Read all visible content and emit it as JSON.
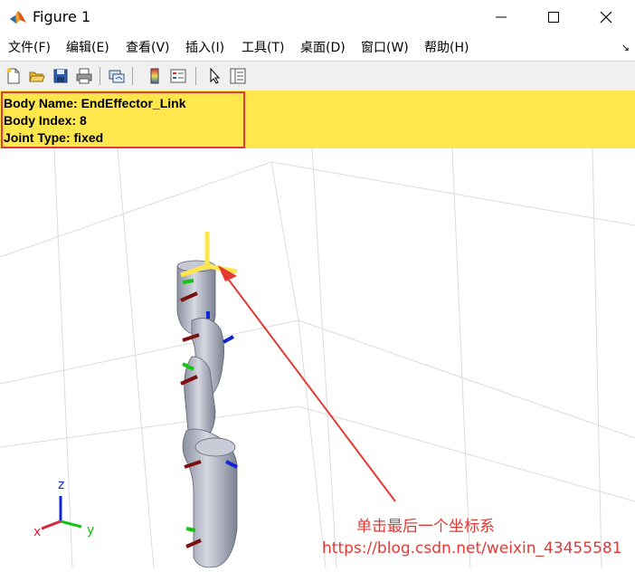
{
  "window": {
    "title": "Figure 1",
    "buttons": [
      "minimize",
      "maximize",
      "close"
    ]
  },
  "menubar": {
    "items": [
      "文件(F)",
      "编辑(E)",
      "查看(V)",
      "插入(I)",
      "工具(T)",
      "桌面(D)",
      "窗口(W)",
      "帮助(H)"
    ],
    "dock_glyph": "↘"
  },
  "toolbar": {
    "buttons": [
      "new-figure-icon",
      "open-file-icon",
      "save-icon",
      "print-icon",
      "link-plot-icon",
      "insert-colorbar-icon",
      "insert-legend-icon",
      "edit-plot-pointer-icon",
      "property-inspector-icon"
    ]
  },
  "datatip": {
    "lines": [
      "Body Name: EndEffector_Link",
      "Body Index: 8",
      "Joint Type: fixed"
    ],
    "background": "#fde74c",
    "highlight_color": "#e53935"
  },
  "axes_triad": {
    "z": "z",
    "x": "x",
    "y": "y"
  },
  "annotation": {
    "caption": "单击最后一个坐标系",
    "watermark": "https://blog.csdn.net/weixin_43455581",
    "color": "#e53935"
  }
}
